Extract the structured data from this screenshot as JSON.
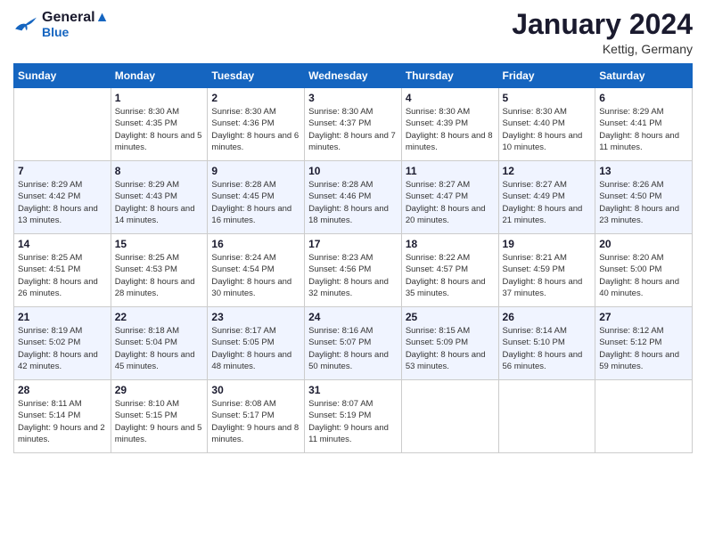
{
  "header": {
    "logo_line1": "General",
    "logo_line2": "Blue",
    "month": "January 2024",
    "location": "Kettig, Germany"
  },
  "days_of_week": [
    "Sunday",
    "Monday",
    "Tuesday",
    "Wednesday",
    "Thursday",
    "Friday",
    "Saturday"
  ],
  "weeks": [
    [
      {
        "day": "",
        "sunrise": "",
        "sunset": "",
        "daylight": ""
      },
      {
        "day": "1",
        "sunrise": "Sunrise: 8:30 AM",
        "sunset": "Sunset: 4:35 PM",
        "daylight": "Daylight: 8 hours and 5 minutes."
      },
      {
        "day": "2",
        "sunrise": "Sunrise: 8:30 AM",
        "sunset": "Sunset: 4:36 PM",
        "daylight": "Daylight: 8 hours and 6 minutes."
      },
      {
        "day": "3",
        "sunrise": "Sunrise: 8:30 AM",
        "sunset": "Sunset: 4:37 PM",
        "daylight": "Daylight: 8 hours and 7 minutes."
      },
      {
        "day": "4",
        "sunrise": "Sunrise: 8:30 AM",
        "sunset": "Sunset: 4:39 PM",
        "daylight": "Daylight: 8 hours and 8 minutes."
      },
      {
        "day": "5",
        "sunrise": "Sunrise: 8:30 AM",
        "sunset": "Sunset: 4:40 PM",
        "daylight": "Daylight: 8 hours and 10 minutes."
      },
      {
        "day": "6",
        "sunrise": "Sunrise: 8:29 AM",
        "sunset": "Sunset: 4:41 PM",
        "daylight": "Daylight: 8 hours and 11 minutes."
      }
    ],
    [
      {
        "day": "7",
        "sunrise": "Sunrise: 8:29 AM",
        "sunset": "Sunset: 4:42 PM",
        "daylight": "Daylight: 8 hours and 13 minutes."
      },
      {
        "day": "8",
        "sunrise": "Sunrise: 8:29 AM",
        "sunset": "Sunset: 4:43 PM",
        "daylight": "Daylight: 8 hours and 14 minutes."
      },
      {
        "day": "9",
        "sunrise": "Sunrise: 8:28 AM",
        "sunset": "Sunset: 4:45 PM",
        "daylight": "Daylight: 8 hours and 16 minutes."
      },
      {
        "day": "10",
        "sunrise": "Sunrise: 8:28 AM",
        "sunset": "Sunset: 4:46 PM",
        "daylight": "Daylight: 8 hours and 18 minutes."
      },
      {
        "day": "11",
        "sunrise": "Sunrise: 8:27 AM",
        "sunset": "Sunset: 4:47 PM",
        "daylight": "Daylight: 8 hours and 20 minutes."
      },
      {
        "day": "12",
        "sunrise": "Sunrise: 8:27 AM",
        "sunset": "Sunset: 4:49 PM",
        "daylight": "Daylight: 8 hours and 21 minutes."
      },
      {
        "day": "13",
        "sunrise": "Sunrise: 8:26 AM",
        "sunset": "Sunset: 4:50 PM",
        "daylight": "Daylight: 8 hours and 23 minutes."
      }
    ],
    [
      {
        "day": "14",
        "sunrise": "Sunrise: 8:25 AM",
        "sunset": "Sunset: 4:51 PM",
        "daylight": "Daylight: 8 hours and 26 minutes."
      },
      {
        "day": "15",
        "sunrise": "Sunrise: 8:25 AM",
        "sunset": "Sunset: 4:53 PM",
        "daylight": "Daylight: 8 hours and 28 minutes."
      },
      {
        "day": "16",
        "sunrise": "Sunrise: 8:24 AM",
        "sunset": "Sunset: 4:54 PM",
        "daylight": "Daylight: 8 hours and 30 minutes."
      },
      {
        "day": "17",
        "sunrise": "Sunrise: 8:23 AM",
        "sunset": "Sunset: 4:56 PM",
        "daylight": "Daylight: 8 hours and 32 minutes."
      },
      {
        "day": "18",
        "sunrise": "Sunrise: 8:22 AM",
        "sunset": "Sunset: 4:57 PM",
        "daylight": "Daylight: 8 hours and 35 minutes."
      },
      {
        "day": "19",
        "sunrise": "Sunrise: 8:21 AM",
        "sunset": "Sunset: 4:59 PM",
        "daylight": "Daylight: 8 hours and 37 minutes."
      },
      {
        "day": "20",
        "sunrise": "Sunrise: 8:20 AM",
        "sunset": "Sunset: 5:00 PM",
        "daylight": "Daylight: 8 hours and 40 minutes."
      }
    ],
    [
      {
        "day": "21",
        "sunrise": "Sunrise: 8:19 AM",
        "sunset": "Sunset: 5:02 PM",
        "daylight": "Daylight: 8 hours and 42 minutes."
      },
      {
        "day": "22",
        "sunrise": "Sunrise: 8:18 AM",
        "sunset": "Sunset: 5:04 PM",
        "daylight": "Daylight: 8 hours and 45 minutes."
      },
      {
        "day": "23",
        "sunrise": "Sunrise: 8:17 AM",
        "sunset": "Sunset: 5:05 PM",
        "daylight": "Daylight: 8 hours and 48 minutes."
      },
      {
        "day": "24",
        "sunrise": "Sunrise: 8:16 AM",
        "sunset": "Sunset: 5:07 PM",
        "daylight": "Daylight: 8 hours and 50 minutes."
      },
      {
        "day": "25",
        "sunrise": "Sunrise: 8:15 AM",
        "sunset": "Sunset: 5:09 PM",
        "daylight": "Daylight: 8 hours and 53 minutes."
      },
      {
        "day": "26",
        "sunrise": "Sunrise: 8:14 AM",
        "sunset": "Sunset: 5:10 PM",
        "daylight": "Daylight: 8 hours and 56 minutes."
      },
      {
        "day": "27",
        "sunrise": "Sunrise: 8:12 AM",
        "sunset": "Sunset: 5:12 PM",
        "daylight": "Daylight: 8 hours and 59 minutes."
      }
    ],
    [
      {
        "day": "28",
        "sunrise": "Sunrise: 8:11 AM",
        "sunset": "Sunset: 5:14 PM",
        "daylight": "Daylight: 9 hours and 2 minutes."
      },
      {
        "day": "29",
        "sunrise": "Sunrise: 8:10 AM",
        "sunset": "Sunset: 5:15 PM",
        "daylight": "Daylight: 9 hours and 5 minutes."
      },
      {
        "day": "30",
        "sunrise": "Sunrise: 8:08 AM",
        "sunset": "Sunset: 5:17 PM",
        "daylight": "Daylight: 9 hours and 8 minutes."
      },
      {
        "day": "31",
        "sunrise": "Sunrise: 8:07 AM",
        "sunset": "Sunset: 5:19 PM",
        "daylight": "Daylight: 9 hours and 11 minutes."
      },
      {
        "day": "",
        "sunrise": "",
        "sunset": "",
        "daylight": ""
      },
      {
        "day": "",
        "sunrise": "",
        "sunset": "",
        "daylight": ""
      },
      {
        "day": "",
        "sunrise": "",
        "sunset": "",
        "daylight": ""
      }
    ]
  ]
}
